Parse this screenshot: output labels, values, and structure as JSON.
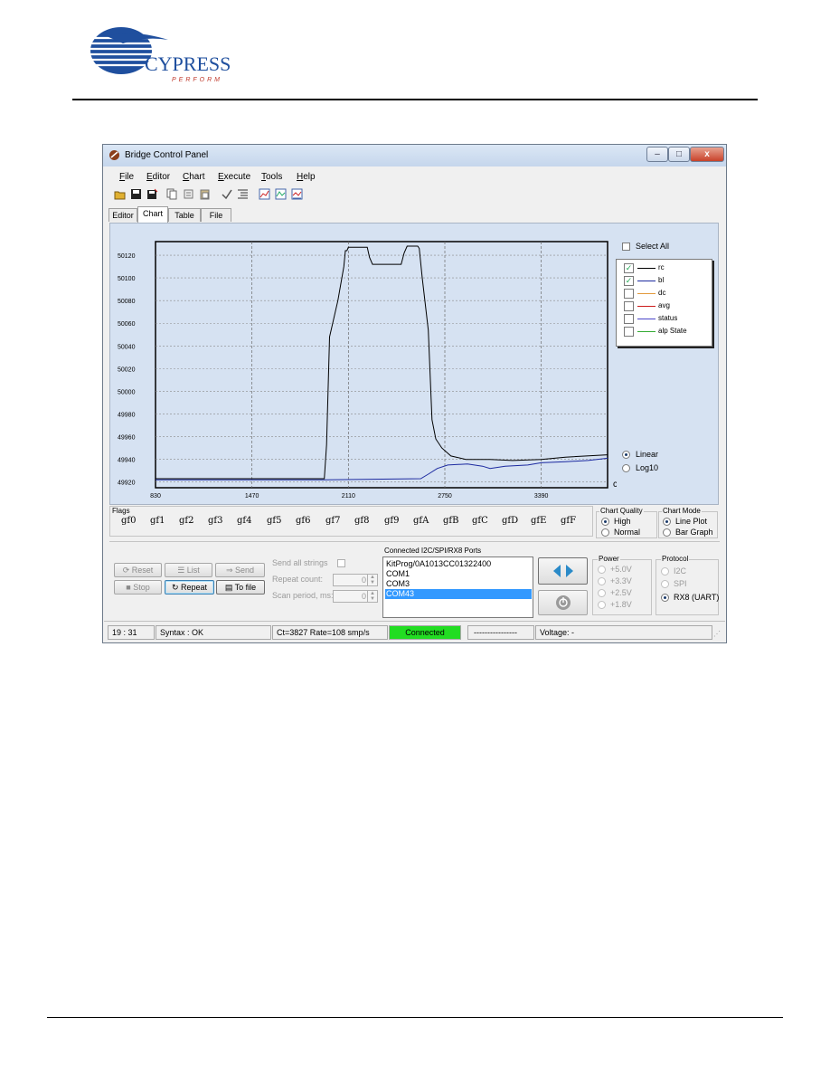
{
  "doc": {
    "logo": {
      "name": "CYPRESS",
      "tagline": "PERFORM"
    }
  },
  "window": {
    "title": "Bridge Control Panel",
    "controls": {
      "minimize": "–",
      "maximize": "□",
      "close": "x"
    }
  },
  "menu": [
    {
      "label": "File",
      "underline": "F",
      "rest": "ile"
    },
    {
      "label": "Editor",
      "underline": "E",
      "rest": "ditor"
    },
    {
      "label": "Chart",
      "underline": "C",
      "rest": "hart"
    },
    {
      "label": "Execute",
      "underline": "E",
      "rest": "xecute"
    },
    {
      "label": "Tools",
      "underline": "T",
      "rest": "ools"
    },
    {
      "label": "Help",
      "underline": "H",
      "rest": "elp"
    }
  ],
  "toolbar_icons": [
    "open-icon",
    "save-icon",
    "save-as-icon",
    "copy-icon",
    "cut-icon",
    "paste-icon",
    "check-syntax-icon",
    "list-icon",
    "chart-icon",
    "chart-config-icon",
    "chart-export-icon"
  ],
  "tabs": [
    {
      "label": "Editor",
      "active": false
    },
    {
      "label": "Chart",
      "active": true
    },
    {
      "label": "Table",
      "active": false
    },
    {
      "label": "File",
      "active": false
    }
  ],
  "chart_data": {
    "type": "line",
    "xlabel": "cnts",
    "xlim": [
      830,
      3830
    ],
    "ylim": [
      49915,
      50132
    ],
    "xticks": [
      "830",
      "1470",
      "2110",
      "2750",
      "3390"
    ],
    "yticks": [
      "50120",
      "50100",
      "50080",
      "50060",
      "50040",
      "50020",
      "50000",
      "49980",
      "49960",
      "49940",
      "49920"
    ],
    "grid": true,
    "series": [
      {
        "name": "rc",
        "color": "#000000",
        "points": [
          [
            830,
            49923
          ],
          [
            1800,
            49923
          ],
          [
            1950,
            49923
          ],
          [
            1965,
            49953
          ],
          [
            1985,
            50048
          ],
          [
            2040,
            50080
          ],
          [
            2080,
            50110
          ],
          [
            2090,
            50124
          ],
          [
            2100,
            50124
          ],
          [
            2110,
            50127
          ],
          [
            2235,
            50127
          ],
          [
            2250,
            50118
          ],
          [
            2270,
            50112
          ],
          [
            2460,
            50112
          ],
          [
            2480,
            50122
          ],
          [
            2500,
            50128
          ],
          [
            2570,
            50128
          ],
          [
            2580,
            50126
          ],
          [
            2600,
            50100
          ],
          [
            2640,
            50054
          ],
          [
            2665,
            49975
          ],
          [
            2690,
            49958
          ],
          [
            2730,
            49950
          ],
          [
            2790,
            49943
          ],
          [
            2890,
            49940
          ],
          [
            3050,
            49940
          ],
          [
            3200,
            49939
          ],
          [
            3390,
            49940
          ],
          [
            3550,
            49942
          ],
          [
            3830,
            49944
          ]
        ]
      },
      {
        "name": "bl",
        "color": "#1c2aa0",
        "points": [
          [
            830,
            49922
          ],
          [
            1550,
            49922
          ],
          [
            1950,
            49922
          ],
          [
            2590,
            49923
          ],
          [
            2640,
            49927
          ],
          [
            2700,
            49932
          ],
          [
            2770,
            49935
          ],
          [
            2900,
            49936
          ],
          [
            3000,
            49934
          ],
          [
            3050,
            49932
          ],
          [
            3150,
            49934
          ],
          [
            3300,
            49935
          ],
          [
            3390,
            49937
          ],
          [
            3550,
            49938
          ],
          [
            3700,
            49939
          ],
          [
            3830,
            49941
          ]
        ]
      }
    ],
    "legend": {
      "select_all": "Select All",
      "entries": [
        {
          "label": "rc",
          "color": "#000000",
          "checked": true
        },
        {
          "label": "bl",
          "color": "#1c2aa0",
          "checked": true
        },
        {
          "label": "dc",
          "color": "#e39a3c",
          "checked": false
        },
        {
          "label": "avg",
          "color": "#cc1a1a",
          "checked": false
        },
        {
          "label": "status",
          "color": "#4a44c8",
          "checked": false
        },
        {
          "label": "alp State",
          "color": "#33aa33",
          "checked": false
        }
      ]
    },
    "scale_options": [
      {
        "label": "Linear",
        "selected": true
      },
      {
        "label": "Log10",
        "selected": false
      }
    ]
  },
  "flags": {
    "title": "Flags",
    "items": [
      "gf0",
      "gf1",
      "gf2",
      "gf3",
      "gf4",
      "gf5",
      "gf6",
      "gf7",
      "gf8",
      "gf9",
      "gfA",
      "gfB",
      "gfC",
      "gfD",
      "gfE",
      "gfF"
    ]
  },
  "chart_quality": {
    "title": "Chart Quality",
    "options": [
      {
        "label": "High",
        "selected": true
      },
      {
        "label": "Normal",
        "selected": false
      }
    ]
  },
  "chart_mode": {
    "title": "Chart Mode",
    "options": [
      {
        "label": "Line Plot",
        "selected": true
      },
      {
        "label": "Bar Graph",
        "selected": false
      }
    ]
  },
  "buttons": {
    "reset": "Reset",
    "list": "List",
    "send": "Send",
    "stop": "Stop",
    "repeat": "Repeat",
    "to_file": "To file"
  },
  "send_options": {
    "send_all_strings": "Send all strings",
    "repeat_count_label": "Repeat count:",
    "repeat_count_value": "0",
    "scan_period_label": "Scan period, ms:",
    "scan_period_value": "0"
  },
  "ports": {
    "title": "Connected I2C/SPI/RX8 Ports",
    "items": [
      {
        "label": "KitProg/0A1013CC01322400",
        "selected": false
      },
      {
        "label": "COM1",
        "selected": false
      },
      {
        "label": "COM3",
        "selected": false
      },
      {
        "label": "COM43",
        "selected": true
      }
    ]
  },
  "power": {
    "title": "Power",
    "options": [
      "+5.0V",
      "+3.3V",
      "+2.5V",
      "+1.8V"
    ]
  },
  "protocol": {
    "title": "Protocol",
    "options": [
      {
        "label": "I2C",
        "selected": false
      },
      {
        "label": "SPI",
        "selected": false
      },
      {
        "label": "RX8 (UART)",
        "selected": true
      }
    ]
  },
  "status": {
    "time": "19 : 31",
    "syntax": "Syntax : OK",
    "rate": "Ct=3827 Rate=108 smp/s",
    "connection": "Connected",
    "connection_color": "#22dd22",
    "dashes": "----------------",
    "voltage": "Voltage: -"
  }
}
